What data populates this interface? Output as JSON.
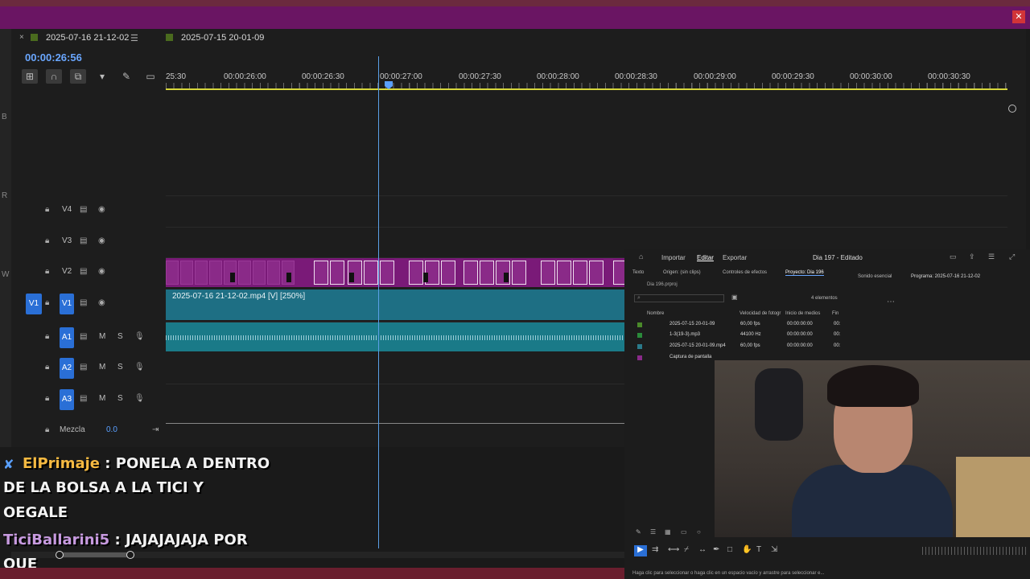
{
  "window": {
    "close_icon": "✕"
  },
  "edge_letters": [
    "B",
    "R",
    "W"
  ],
  "sequence_tabs": {
    "active": "2025-07-16 21-12-02",
    "inactive": "2025-07-15 20-01-09"
  },
  "timecode": "00:00:26:56",
  "ruler_labels": [
    "25:30",
    "00:00:26:00",
    "00:00:26:30",
    "00:00:27:00",
    "00:00:27:30",
    "00:00:28:00",
    "00:00:28:30",
    "00:00:29:00",
    "00:00:29:30",
    "00:00:30:00",
    "00:00:30:30"
  ],
  "tracks": {
    "v4": "V4",
    "v3": "V3",
    "v2": "V2",
    "v1": "V1",
    "v1_source": "V1",
    "a1": "A1",
    "a2": "A2",
    "a3": "A3",
    "mute": "M",
    "solo": "S"
  },
  "mix": {
    "label": "Mezcla",
    "value": "0.0"
  },
  "v1_clip_label": "2025-07-16 21-12-02.mp4 [V] [250%]",
  "program": {
    "workspaces": [
      "Importar",
      "Editar",
      "Exportar"
    ],
    "active_workspace": "Editar",
    "doc_title": "Dia 197 - Editado",
    "sub_tabs": [
      "Texto",
      "Origen: (sin clips)",
      "Controles de efectos",
      "Proyecto: Dia 196"
    ],
    "active_sub_tab": "Proyecto: Dia 196",
    "project_file": "Dia 196.prproj",
    "item_count": "4 elementos",
    "columns": [
      "Nombre",
      "Velocidad de fotogr",
      "Inicio de medios",
      "Fin"
    ],
    "rows": [
      {
        "name": "2025-07-15 20-01-09",
        "fps": "60,00 fps",
        "start": "00:00:00:00",
        "end": "00:",
        "color": "#4a8a2a"
      },
      {
        "name": "1-3(19-3).mp3",
        "fps": "44100 Hz",
        "start": "00:00:00:00",
        "end": "00:",
        "color": "#2a8a3a"
      },
      {
        "name": "2025-07-15 20-01-09.mp4",
        "fps": "60,00 fps",
        "start": "00:00:00:00",
        "end": "00:",
        "color": "#2a7a8a"
      },
      {
        "name": "Captura de pantalla",
        "fps": "",
        "start": "",
        "end": "",
        "color": "#8a2a8a"
      }
    ],
    "essential_sound": "Sonido esencial",
    "program_label": "Programa: 2025-07-16 21-12-02",
    "status": "Haga clic para seleccionar o haga clic en un espacio vacío y arrastre para seleccionar e..."
  },
  "chat": [
    {
      "user": "ElPrimaje",
      "text": ": PONELA A DENTRO"
    },
    {
      "user": "",
      "text": "DE LA BOLSA A LA TICI Y"
    },
    {
      "user": "",
      "text": "OEGALE"
    },
    {
      "user": "TiciBallarini5",
      "text": ": JAJAJAJAJA POR"
    },
    {
      "user": "",
      "text": "QUE"
    }
  ]
}
